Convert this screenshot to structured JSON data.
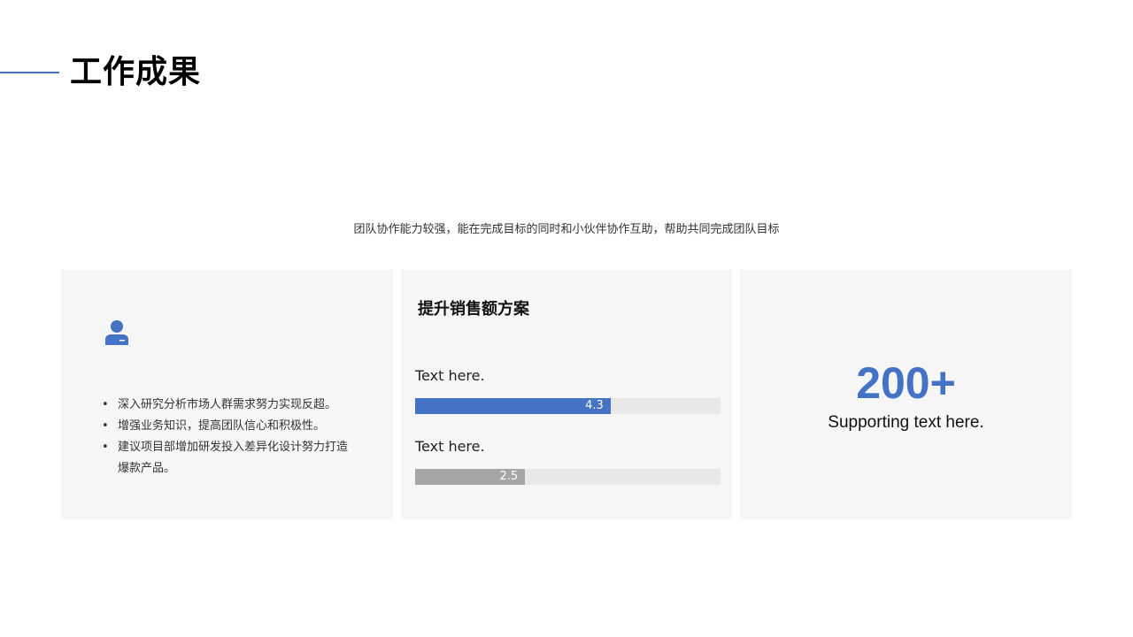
{
  "header": {
    "title": "工作成果",
    "subtitle": "团队协作能力较强，能在完成目标的同时和小伙伴协作互助，帮助共同完成团队目标"
  },
  "card_1": {
    "icon": "user-icon",
    "bullets": [
      "深入研究分析市场人群需求努力实现反超。",
      "增强业务知识，提高团队信心和积极性。",
      "建议项目部增加研发投入差异化设计努力打造爆款产品。"
    ]
  },
  "card_2": {
    "title": "提升销售额方案",
    "metrics": [
      {
        "label": "Text here.",
        "value": "4.3",
        "fraction": 0.64,
        "color": "#4472c4"
      },
      {
        "label": "Text here.",
        "value": "2.5",
        "fraction": 0.36,
        "color": "#a5a5a5"
      }
    ]
  },
  "card_3": {
    "value": "200+",
    "supporting_text": "Supporting text here."
  },
  "colors": {
    "accent": "#4472c4",
    "card_background": "#f6f6f6",
    "track": "#e8e8e8",
    "secondary_bar": "#a5a5a5"
  }
}
